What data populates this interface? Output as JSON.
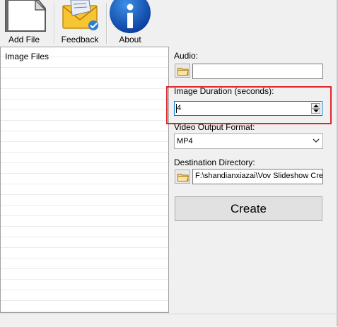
{
  "toolbar": {
    "add_file": "Add File",
    "feedback": "Feedback",
    "about": "About"
  },
  "files_panel": {
    "header": "Image Files"
  },
  "audio": {
    "label": "Audio:",
    "value": ""
  },
  "image_duration": {
    "label": "Image Duration (seconds):",
    "value": "4"
  },
  "video_output_format": {
    "label": "Video Output Format:",
    "selected": "MP4"
  },
  "destination_directory": {
    "label": "Destination Directory:",
    "value": "F:\\shandianxiazai\\Vov Slideshow Crea"
  },
  "create_button": "Create",
  "colors": {
    "highlight": "#e0262a",
    "focus": "#0078d7"
  }
}
